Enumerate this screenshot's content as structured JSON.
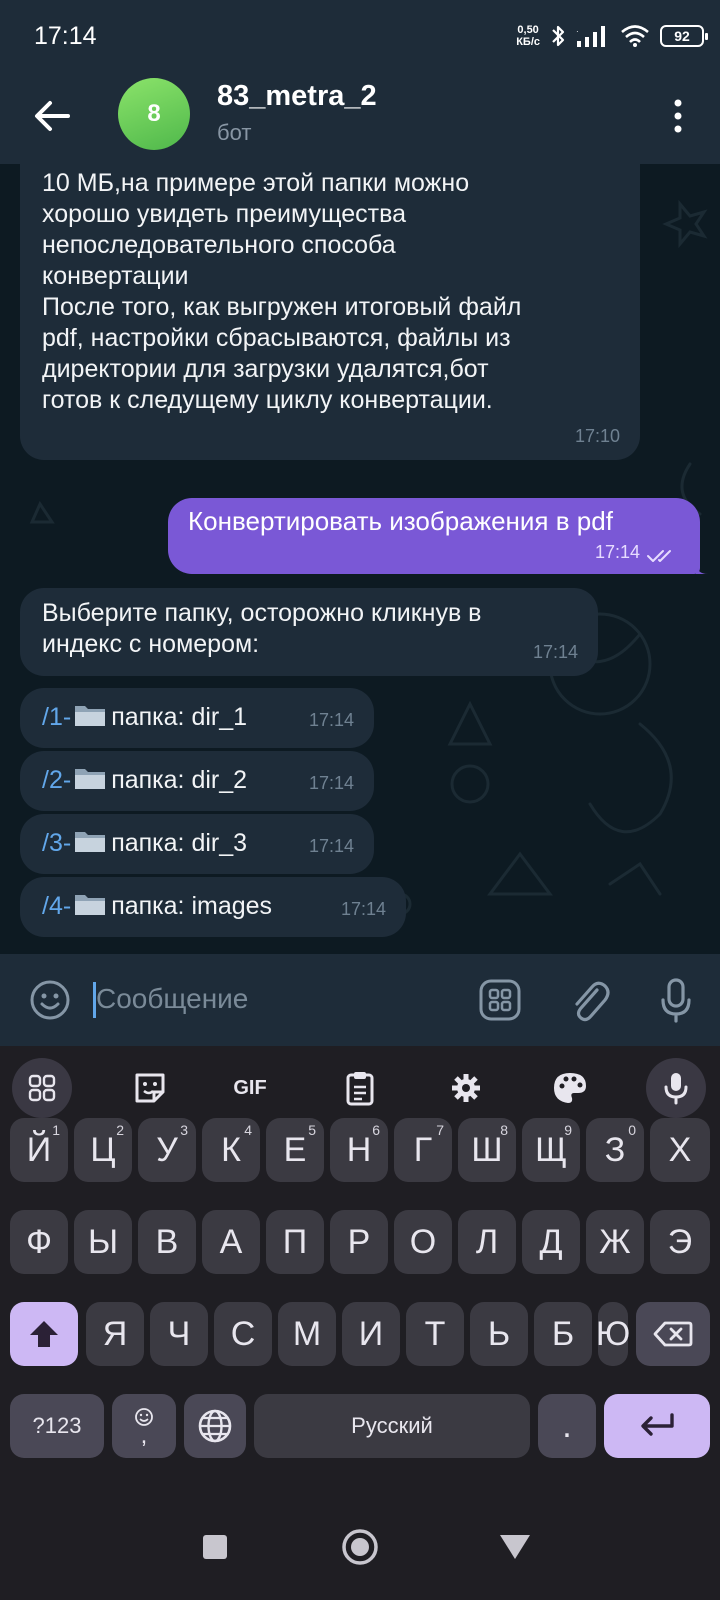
{
  "status_bar": {
    "time": "17:14",
    "speed_value": "0,50",
    "speed_unit": "КБ/с",
    "battery": "92"
  },
  "header": {
    "avatar_letter": "8",
    "title": "83_metra_2",
    "subtitle": "бот",
    "avatar_color": "#5cc353"
  },
  "messages": [
    {
      "from": "bot",
      "lines": [
        "10 МБ,на примере этой папки можно",
        "хорошо увидеть преимущества",
        "непоследовательного способа",
        "конвертации",
        "После того, как выгружен итоговый файл",
        "pdf, настройки сбрасываются, файлы из",
        "директории для загрузки удалятся,бот",
        "готов к следущему циклу конвертации."
      ],
      "time": "17:10"
    },
    {
      "from": "user",
      "text": "Конвертировать изображения в pdf",
      "time": "17:14"
    },
    {
      "from": "bot",
      "lines": [
        "Выберите папку, осторожно кликнув в",
        "индекс с номером:"
      ],
      "time": "17:14"
    }
  ],
  "folders": [
    {
      "command": "/1-",
      "text": "папка: dir_1",
      "time": "17:14"
    },
    {
      "command": "/2-",
      "text": "папка: dir_2",
      "time": "17:14"
    },
    {
      "command": "/3-",
      "text": "папка: dir_3",
      "time": "17:14"
    },
    {
      "command": "/4-",
      "text": "папка: images",
      "time": "17:14"
    }
  ],
  "input": {
    "placeholder": "Сообщение"
  },
  "keyboard": {
    "row1": [
      {
        "key": "Й",
        "sup": "1"
      },
      {
        "key": "Ц",
        "sup": "2"
      },
      {
        "key": "У",
        "sup": "3"
      },
      {
        "key": "К",
        "sup": "4"
      },
      {
        "key": "Е",
        "sup": "5"
      },
      {
        "key": "Н",
        "sup": "6"
      },
      {
        "key": "Г",
        "sup": "7"
      },
      {
        "key": "Ш",
        "sup": "8"
      },
      {
        "key": "Щ",
        "sup": "9"
      },
      {
        "key": "З",
        "sup": "0"
      },
      {
        "key": "Х",
        "sup": ""
      }
    ],
    "row2": [
      "Ф",
      "Ы",
      "В",
      "А",
      "П",
      "Р",
      "О",
      "Л",
      "Д",
      "Ж",
      "Э"
    ],
    "row3": [
      "Я",
      "Ч",
      "С",
      "М",
      "И",
      "Т",
      "Ь",
      "Б",
      "Ю"
    ],
    "numbers_key": "?123",
    "comma": ",",
    "space_label": "Русский",
    "period": ".",
    "toolbar_gif": "GIF"
  },
  "colors": {
    "accent": "#62a7ea",
    "outgoing_bubble": "#7a58d6",
    "incoming_bubble": "#1e2c39"
  }
}
